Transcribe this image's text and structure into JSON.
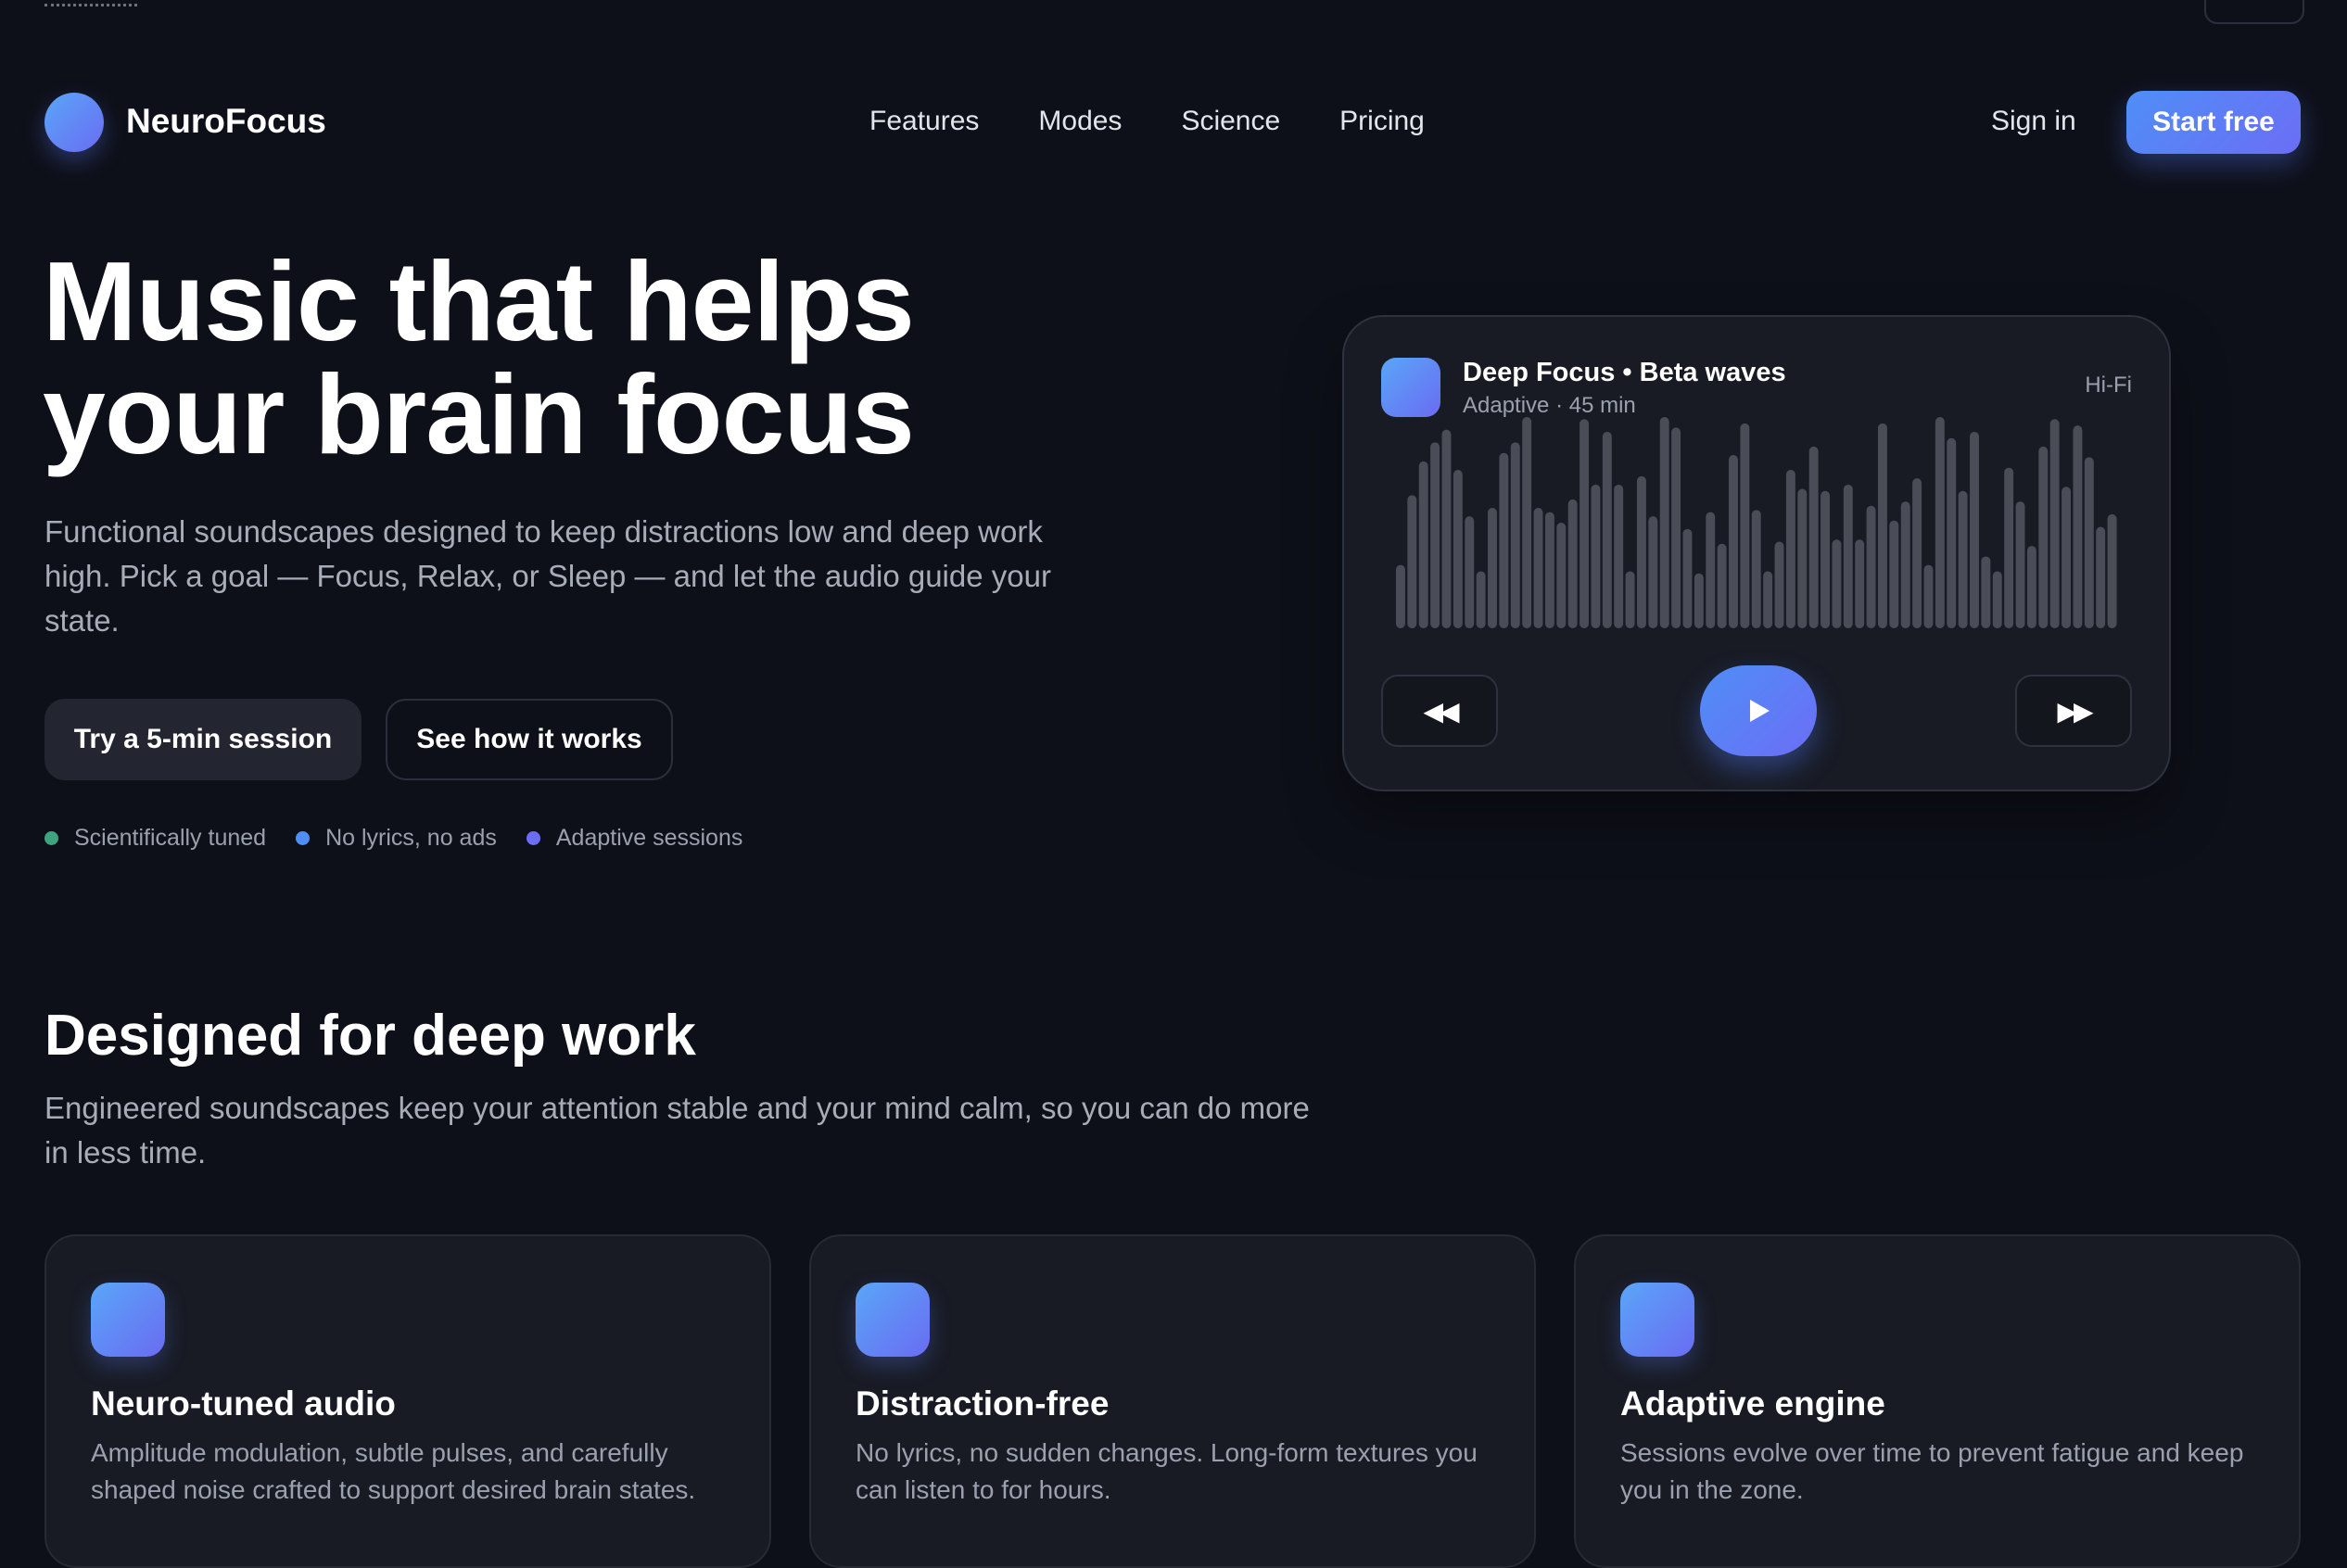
{
  "nav": {
    "brand": "NeuroFocus",
    "links": [
      "Features",
      "Modes",
      "Science",
      "Pricing"
    ],
    "sign_in": "Sign in",
    "start_free": "Start free"
  },
  "hero": {
    "title_line1": "Music that helps",
    "title_line2": "your brain focus",
    "subtitle": "Functional soundscapes designed to keep distractions low and deep work high. Pick a goal — Focus, Relax, or Sleep — and let the audio guide your state.",
    "primary_cta": "Try a 5-min session",
    "secondary_cta": "See how it works",
    "badges": [
      {
        "label": "Scientifically tuned",
        "color": "#3ea37e"
      },
      {
        "label": "No lyrics, no ads",
        "color": "#4f8ef7"
      },
      {
        "label": "Adaptive sessions",
        "color": "#6b6ef5"
      }
    ]
  },
  "player": {
    "title": "Deep Focus • Beta waves",
    "meta": "Adaptive · 45 min",
    "quality": "Hi-Fi",
    "prev_icon": "rewind-icon",
    "play_icon": "play-icon",
    "next_icon": "fast-forward-icon",
    "waveform_levels": [
      0.3,
      0.63,
      0.79,
      0.88,
      0.94,
      0.75,
      0.53,
      0.27,
      0.57,
      0.83,
      0.88,
      1.0,
      0.57,
      0.55,
      0.5,
      0.61,
      0.99,
      0.68,
      0.93,
      0.68,
      0.27,
      0.72,
      0.53,
      1.0,
      0.95,
      0.47,
      0.26,
      0.55,
      0.4,
      0.82,
      0.97,
      0.56,
      0.27,
      0.41,
      0.75,
      0.66,
      0.86,
      0.65,
      0.42,
      0.68,
      0.42,
      0.58,
      0.97,
      0.51,
      0.6,
      0.71,
      0.3,
      1.0,
      0.9,
      0.65,
      0.93,
      0.34,
      0.27,
      0.76,
      0.6,
      0.39,
      0.86,
      0.99,
      0.67,
      0.96,
      0.81,
      0.48,
      0.54
    ]
  },
  "features": {
    "title": "Designed for deep work",
    "subtitle": "Engineered soundscapes keep your attention stable and your mind calm, so you can do more in less time.",
    "cards": [
      {
        "title": "Neuro-tuned audio",
        "text": "Amplitude modulation, subtle pulses, and carefully shaped noise crafted to support desired brain states."
      },
      {
        "title": "Distraction-free",
        "text": "No lyrics, no sudden changes. Long-form textures you can listen to for hours."
      },
      {
        "title": "Adaptive engine",
        "text": "Sessions evolve over time to prevent fatigue and keep you in the zone."
      }
    ]
  },
  "colors": {
    "background": "#0e1019",
    "accent_start": "#4f8ef7",
    "accent_end": "#6b6ef5",
    "card": "#181b24"
  }
}
